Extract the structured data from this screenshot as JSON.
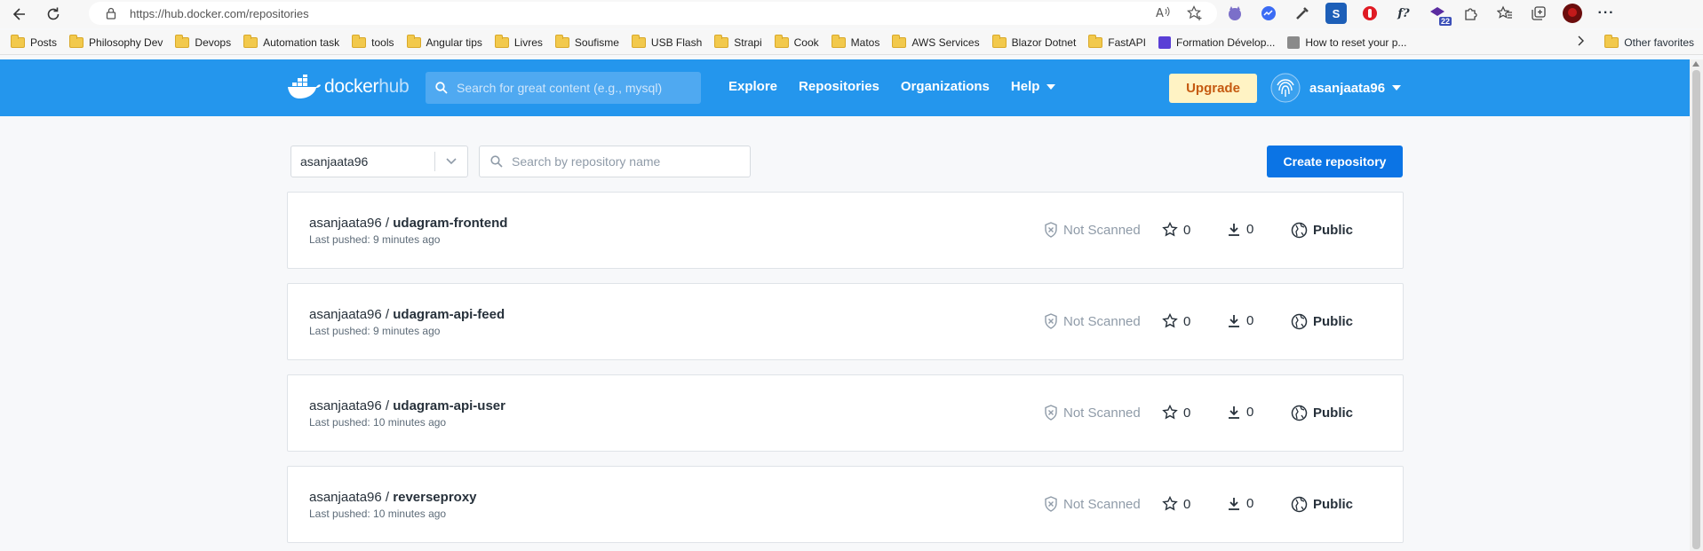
{
  "browser": {
    "url": "https://hub.docker.com/repositories",
    "extension_badge": "22"
  },
  "bookmarks": {
    "items": [
      "Posts",
      "Philosophy Dev",
      "Devops",
      "Automation task",
      "tools",
      "Angular tips",
      "Livres",
      "Soufisme",
      "USB Flash",
      "Strapi",
      "Cook",
      "Matos",
      "AWS Services",
      "Blazor Dotnet",
      "FastAPI",
      "Formation Dévelop...",
      "How to reset your p..."
    ],
    "other": "Other favorites"
  },
  "header": {
    "logo_docker": "docker",
    "logo_hub": "hub",
    "search_placeholder": "Search for great content (e.g., mysql)",
    "nav": [
      "Explore",
      "Repositories",
      "Organizations",
      "Help"
    ],
    "upgrade_label": "Upgrade",
    "username": "asanjaata96"
  },
  "controls": {
    "namespace": "asanjaata96",
    "repo_search_placeholder": "Search by repository name",
    "create_label": "Create repository"
  },
  "repositories": [
    {
      "namespace": "asanjaata96",
      "name": "udagram-frontend",
      "pushed": "Last pushed: 9 minutes ago",
      "scan": "Not Scanned",
      "stars": "0",
      "pulls": "0",
      "visibility": "Public"
    },
    {
      "namespace": "asanjaata96",
      "name": "udagram-api-feed",
      "pushed": "Last pushed: 9 minutes ago",
      "scan": "Not Scanned",
      "stars": "0",
      "pulls": "0",
      "visibility": "Public"
    },
    {
      "namespace": "asanjaata96",
      "name": "udagram-api-user",
      "pushed": "Last pushed: 10 minutes ago",
      "scan": "Not Scanned",
      "stars": "0",
      "pulls": "0",
      "visibility": "Public"
    },
    {
      "namespace": "asanjaata96",
      "name": "reverseproxy",
      "pushed": "Last pushed: 10 minutes ago",
      "scan": "Not Scanned",
      "stars": "0",
      "pulls": "0",
      "visibility": "Public"
    }
  ],
  "colors": {
    "header_bg": "#2496ed",
    "primary_button": "#0b74e5",
    "upgrade_bg": "#fff3c4",
    "upgrade_text": "#c55a11"
  }
}
